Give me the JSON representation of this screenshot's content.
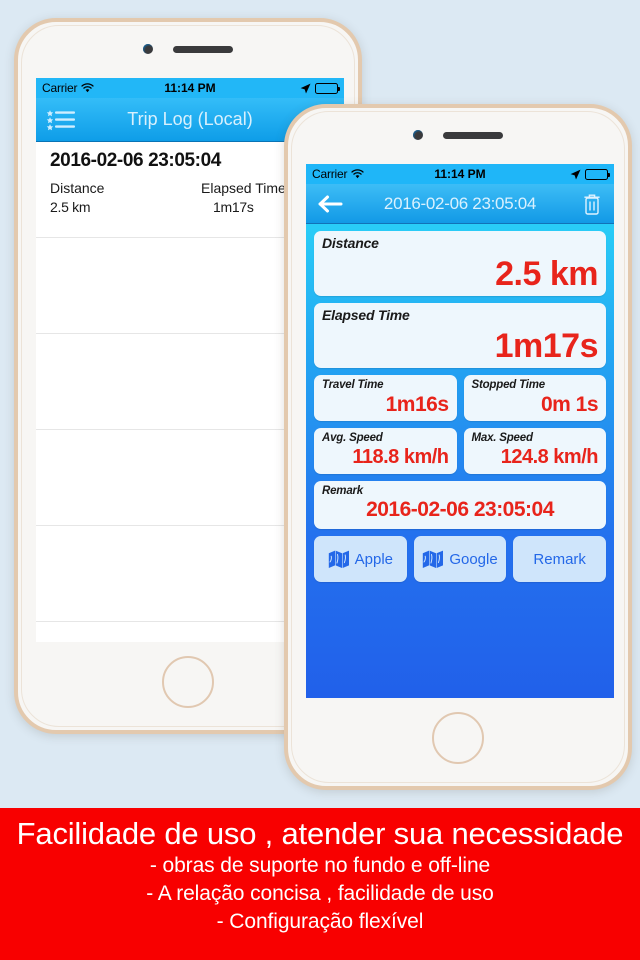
{
  "theme": {
    "page_background": "#dce9f3",
    "accent_red": "#e8241b",
    "nav_blue": "#1299e6",
    "banner_red": "#f80000",
    "card_background": "#eef7fd",
    "button_blue": "#2468e8",
    "bezel_gold": "#e3c9ae"
  },
  "status_bar": {
    "carrier": "Carrier",
    "wifi_icon": "wifi-icon",
    "time": "11:14 PM",
    "location_icon": "location-arrow-icon",
    "battery_icon": "battery-full-icon"
  },
  "back_phone": {
    "screen_name": "trip-log-list",
    "navbar": {
      "menu_icon": "list-bullet-icon",
      "title": "Trip Log (Local)"
    },
    "list": {
      "columns": [
        "Distance",
        "Elapsed Time"
      ],
      "rows": [
        {
          "date": "2016-02-06 23:05:04",
          "distance_label": "Distance",
          "distance_value": "2.5 km",
          "elapsed_label": "Elapsed Time",
          "elapsed_value": "1m17s"
        }
      ],
      "empty_row_count": 4
    }
  },
  "front_phone": {
    "screen_name": "trip-detail",
    "navbar": {
      "back_icon": "arrow-left-icon",
      "title": "2016-02-06 23:05:04",
      "delete_icon": "trash-icon"
    },
    "cards": {
      "distance": {
        "label": "Distance",
        "value": "2.5 km"
      },
      "elapsed_time": {
        "label": "Elapsed Time",
        "value": "1m17s"
      },
      "travel_time": {
        "label": "Travel Time",
        "value": "1m16s"
      },
      "stopped_time": {
        "label": "Stopped Time",
        "value": "0m 1s"
      },
      "avg_speed": {
        "label": "Avg. Speed",
        "value": "118.8 km/h"
      },
      "max_speed": {
        "label": "Max. Speed",
        "value": "124.8 km/h"
      },
      "remark": {
        "label": "Remark",
        "value": "2016-02-06 23:05:04"
      }
    },
    "buttons": [
      {
        "label": "Apple",
        "icon": "map-icon"
      },
      {
        "label": "Google",
        "icon": "map-icon"
      },
      {
        "label": "Remark",
        "icon": ""
      }
    ]
  },
  "banner": {
    "headline": "Facilidade de uso , atender sua necessidade",
    "lines": [
      "- obras de suporte no fundo e off-line",
      "- A relação concisa , facilidade de uso",
      "- Configuração flexível"
    ]
  }
}
